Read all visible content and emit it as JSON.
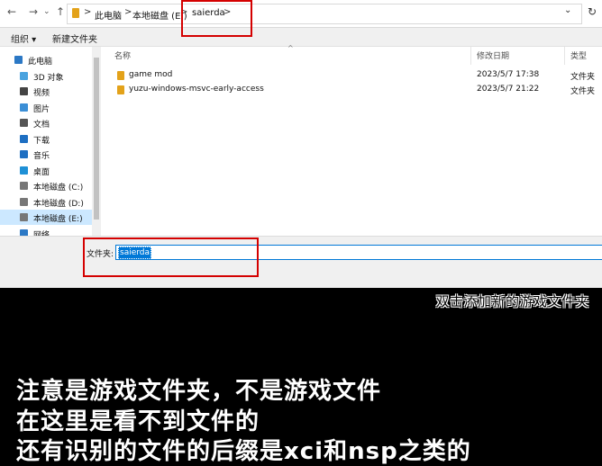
{
  "address": {
    "crumbs": [
      "此电脑",
      "本地磁盘 (E:)",
      "saierda"
    ],
    "sep": ">"
  },
  "toolbar": {
    "organize": "组织 ▾",
    "new_folder": "新建文件夹"
  },
  "nav": {
    "items": [
      {
        "label": "此电脑",
        "icon": "computer-icon"
      },
      {
        "label": "3D 对象",
        "icon": "cube-icon"
      },
      {
        "label": "视频",
        "icon": "video-icon"
      },
      {
        "label": "图片",
        "icon": "picture-icon"
      },
      {
        "label": "文档",
        "icon": "document-icon"
      },
      {
        "label": "下载",
        "icon": "download-icon"
      },
      {
        "label": "音乐",
        "icon": "music-icon"
      },
      {
        "label": "桌面",
        "icon": "desktop-icon"
      },
      {
        "label": "本地磁盘 (C:)",
        "icon": "drive-icon"
      },
      {
        "label": "本地磁盘 (D:)",
        "icon": "drive-icon"
      },
      {
        "label": "本地磁盘 (E:)",
        "icon": "drive-icon"
      },
      {
        "label": "网络",
        "icon": "network-icon"
      }
    ]
  },
  "list": {
    "headers": {
      "name": "名称",
      "date": "修改日期",
      "type": "类型"
    },
    "rows": [
      {
        "name": "game mod",
        "date": "2023/5/7 17:38",
        "type": "文件夹"
      },
      {
        "name": "yuzu-windows-msvc-early-access",
        "date": "2023/5/7 21:22",
        "type": "文件夹"
      }
    ]
  },
  "folder_field": {
    "label": "文件夹:",
    "value": "saierda"
  },
  "overlay": {
    "hint": "双击添加新的游戏文件夹",
    "lines": [
      "注意是游戏文件夹，不是游戏文件",
      "在这里是看不到文件的",
      "还有识别的文件的后缀是xci和nsp之类的"
    ]
  },
  "colors": {
    "highlight": "#d40000",
    "selection": "#0078d7",
    "folder": "#e3a21a"
  }
}
